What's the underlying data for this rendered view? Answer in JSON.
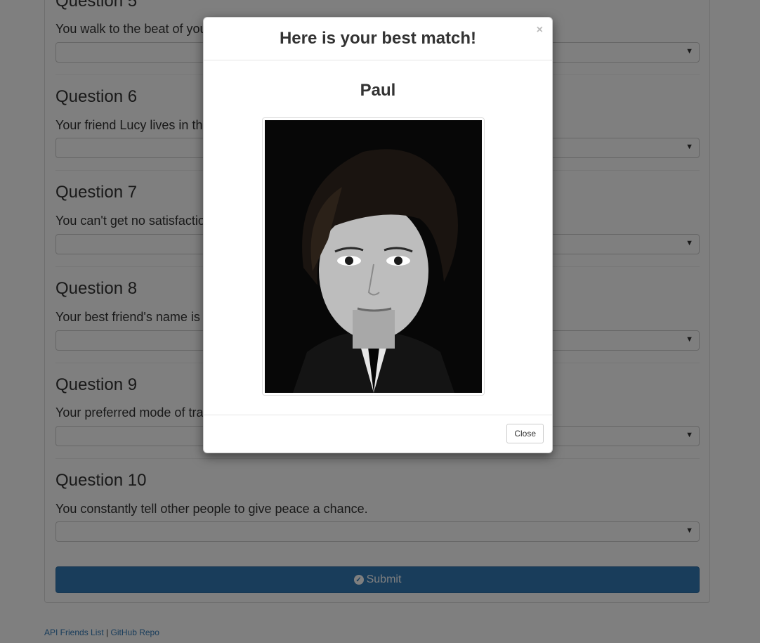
{
  "questions": [
    {
      "title": "Question 5",
      "text": "You walk to the beat of your own drum."
    },
    {
      "title": "Question 6",
      "text": "Your friend Lucy lives in the sky with diamonds."
    },
    {
      "title": "Question 7",
      "text": "You can't get no satisfaction."
    },
    {
      "title": "Question 8",
      "text": "Your best friend's name is Jude."
    },
    {
      "title": "Question 9",
      "text": "Your preferred mode of transportation is a yellow submarine."
    },
    {
      "title": "Question 10",
      "text": "You constantly tell other people to give peace a chance."
    }
  ],
  "submit": {
    "label": "Submit",
    "icon": "check-circle-icon"
  },
  "footer": {
    "link1": "API Friends List",
    "separator": "|",
    "link2": "GitHub Repo"
  },
  "modal": {
    "title": "Here is your best match!",
    "close_x": "×",
    "name": "Paul",
    "photo": "portrait-photo",
    "close_label": "Close"
  },
  "colors": {
    "primary": "#337ab7",
    "backdrop": "rgba(0,0,0,0.5)"
  }
}
